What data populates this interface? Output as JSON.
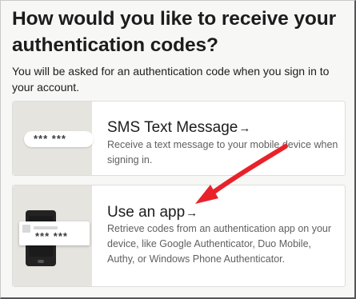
{
  "page": {
    "heading": "How would you like to receive your authentication codes?",
    "intro": "You will be asked for an authentication code when you sign in to your account."
  },
  "options": [
    {
      "title": "SMS Text Message",
      "arrow": "→",
      "description": "Receive a text message to your mobile device when signing in.",
      "illustration_code": "*** ***"
    },
    {
      "title": "Use an app",
      "arrow": "→",
      "description": "Retrieve codes from an authentication app on your device, like Google Authenticator, Duo Mobile, Authy, or Windows Phone Authenticator.",
      "illustration_code": "*** ***"
    }
  ],
  "colors": {
    "background": "#f7f7f6",
    "card": "#ffffff",
    "illustration_bg": "#e6e4df",
    "annotation_arrow": "#e8222a"
  }
}
